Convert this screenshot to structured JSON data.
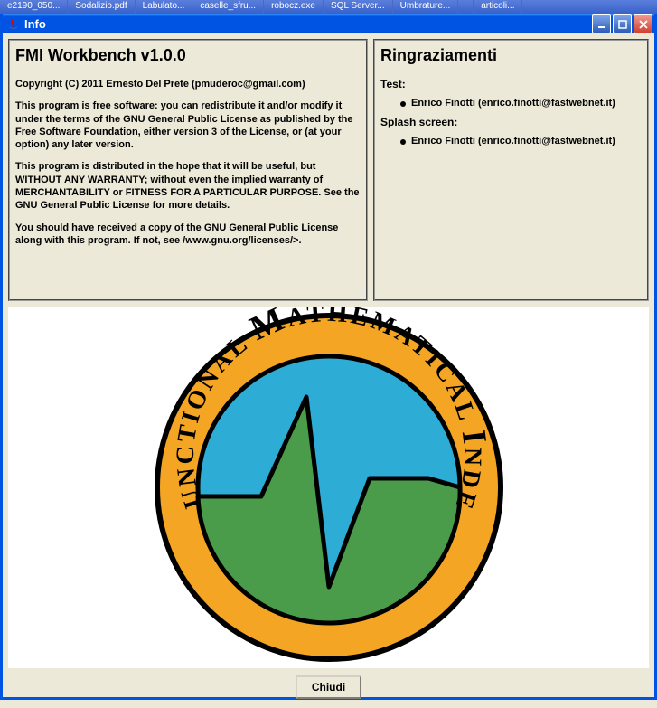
{
  "taskbar": {
    "items": [
      "e2190_050...",
      "Sodalizio.pdf",
      "Labulato...",
      "caselle_sfru...",
      "robocz.exe",
      "SQL Server...",
      "Umbrature...",
      "",
      "articoli..."
    ]
  },
  "window": {
    "title": "Info"
  },
  "left_panel": {
    "heading": "FMI Workbench v1.0.0",
    "copyright": "Copyright (C) 2011 Ernesto Del Prete (pmuderoc@gmail.com)",
    "para1": "This program is free software: you can redistribute it and/or modify it under the terms of the GNU General Public License as published by the Free Software Foundation, either version 3 of the License, or (at your option) any later version.",
    "para2": "This program is distributed in the hope that it will be useful, but WITHOUT ANY WARRANTY; without even the implied warranty of MERCHANTABILITY or FITNESS FOR A PARTICULAR PURPOSE. See the GNU General Public License for more details.",
    "para3": "You should have received a copy of the GNU General Public License along with this program. If not, see /www.gnu.org/licenses/>."
  },
  "right_panel": {
    "heading": "Ringraziamenti",
    "test_label": "Test:",
    "test_item": "Enrico Finotti (enrico.finotti@fastwebnet.it)",
    "splash_label": "Splash screen:",
    "splash_item": "Enrico Finotti (enrico.finotti@fastwebnet.it)"
  },
  "logo": {
    "text_top": "FUNCTIONAL MATHEMATICAL INDEX"
  },
  "buttons": {
    "close": "Chiudi"
  }
}
